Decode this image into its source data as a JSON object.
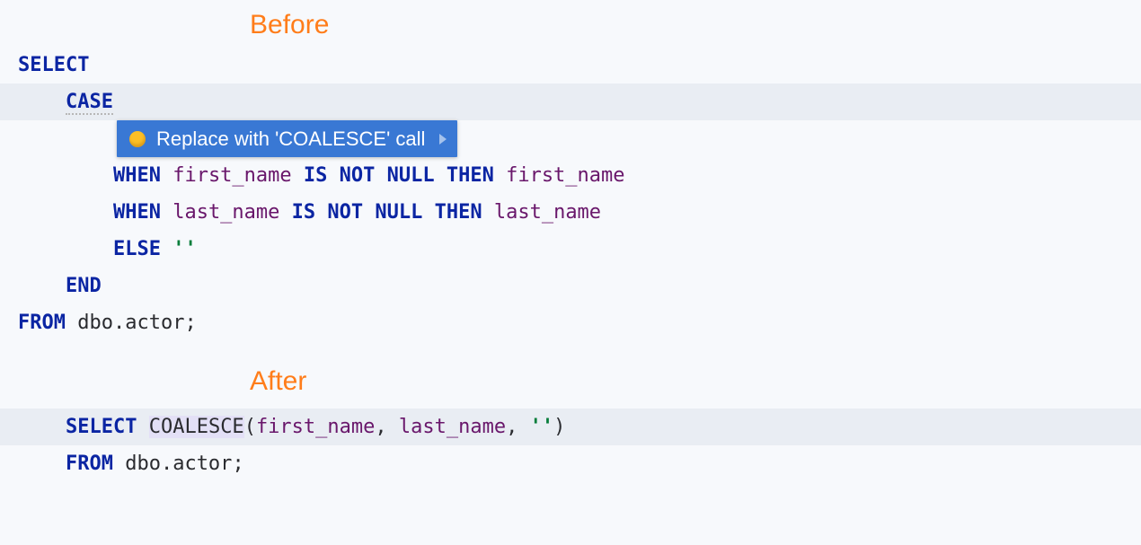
{
  "labels": {
    "before": "Before",
    "after": "After"
  },
  "intention": {
    "label": "Replace with 'COALESCE' call"
  },
  "before": {
    "l1": {
      "select": "SELECT"
    },
    "l2": {
      "case": "CASE"
    },
    "l4": {
      "when": "WHEN",
      "col": "first_name",
      "isnotnullthen": "IS NOT NULL THEN",
      "then_col": "first_name"
    },
    "l5": {
      "when": "WHEN",
      "col": "last_name",
      "isnotnullthen": "IS NOT NULL THEN",
      "then_col": "last_name"
    },
    "l6": {
      "else": "ELSE",
      "lit": "''"
    },
    "l7": {
      "end": "END"
    },
    "l8": {
      "from": "FROM",
      "tbl": "dbo.actor",
      "semi": ";"
    }
  },
  "after": {
    "l1": {
      "select": "SELECT",
      "fn": "COALESCE",
      "open": "(",
      "a1": "first_name",
      "c1": ", ",
      "a2": "last_name",
      "c2": ", ",
      "lit": "''",
      "close": ")"
    },
    "l2": {
      "from": "FROM",
      "tbl": "dbo.actor",
      "semi": ";"
    }
  }
}
